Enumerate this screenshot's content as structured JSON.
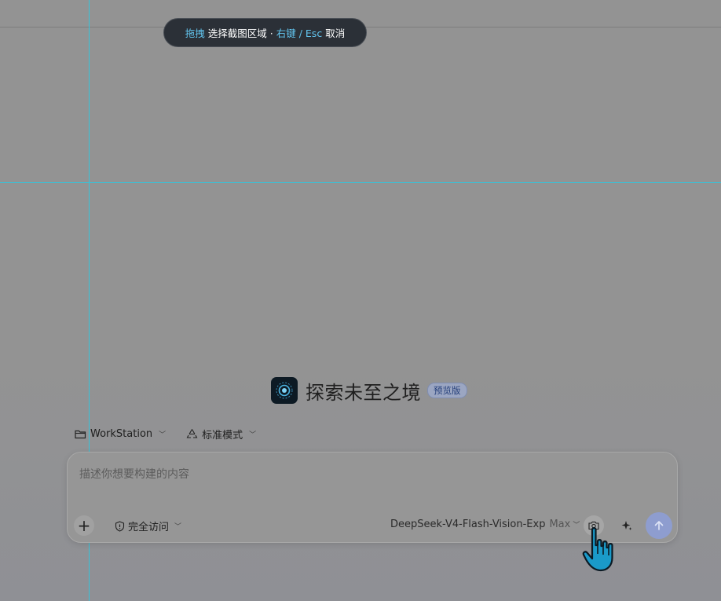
{
  "overlay": {
    "hint_drag": "拖拽",
    "hint_select": "选择截图区域 ·",
    "hint_keys": "右键 / Esc",
    "hint_cancel": "取消"
  },
  "hero": {
    "title": "探索未至之境",
    "badge": "预览版"
  },
  "toolbar": {
    "workspace": "WorkStation",
    "mode": "标准模式"
  },
  "composer": {
    "placeholder": "描述你想要构建的内容",
    "access": "完全访问",
    "model": "DeepSeek-V4-Flash-Vision-Exp",
    "model_tier": "Max"
  },
  "icons": {
    "folder": "folder-icon",
    "mode": "recycle-icon",
    "shield": "shield-icon",
    "camera": "camera-icon",
    "sparkle": "sparkle-icon",
    "send": "arrow-up-icon",
    "cursor": "hand-pointer-icon"
  },
  "colors": {
    "accent_hint": "#62c4ee",
    "send_button": "#8e9dcf",
    "guide_line": "#37c2d9"
  }
}
